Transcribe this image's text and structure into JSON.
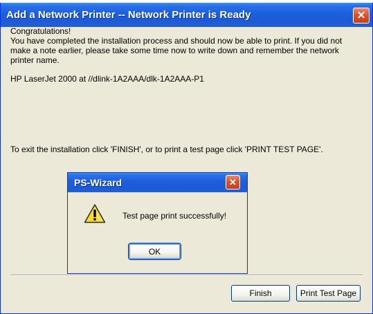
{
  "main_window": {
    "title": "Add a Network Printer -- Network Printer is Ready",
    "close_glyph": "✕",
    "congrats_heading": "Congratulations!",
    "congrats_body": "You have completed the installation process and should now be able to print. If you did not make a note earlier, please take some time now to write down and remember the network printer name.",
    "printer_name": "HP LaserJet 2000 at //dlink-1A2AAA/dlk-1A2AAA-P1",
    "exit_instructions": "To exit the installation click 'FINISH', or to print a test page click 'PRINT TEST PAGE'.",
    "finish_label": "Finish",
    "print_test_label": "Print Test Page"
  },
  "wizard_dialog": {
    "title": "PS-Wizard",
    "close_glyph": "✕",
    "icon": "warning-icon",
    "message": "Test page print successfully!",
    "ok_label": "OK"
  },
  "colors": {
    "titlebar_blue": "#1c5fdd",
    "dialog_face": "#ece9d8",
    "close_red": "#d9522c",
    "warning_yellow": "#f9d92b"
  }
}
